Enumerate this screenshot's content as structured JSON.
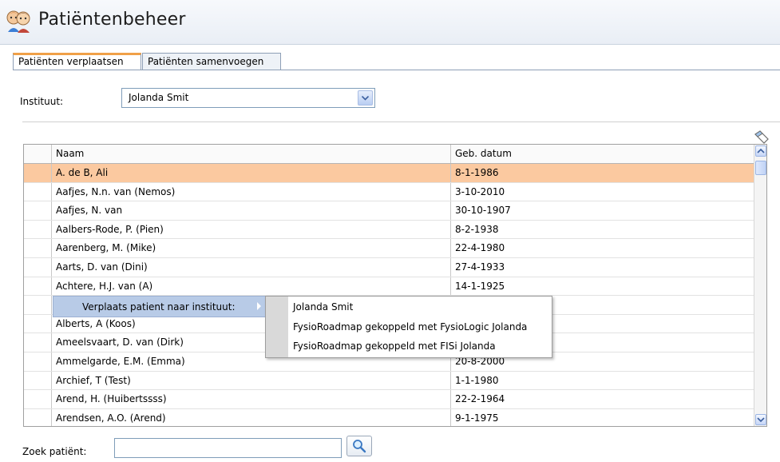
{
  "header": {
    "title": "Patiëntenbeheer"
  },
  "tabs": [
    {
      "label": "Patiënten verplaatsen",
      "active": true
    },
    {
      "label": "Patiënten samenvoegen",
      "active": false
    }
  ],
  "institute": {
    "label": "Instituut:",
    "value": "Jolanda Smit"
  },
  "table": {
    "columns": [
      "Naam",
      "Geb. datum"
    ],
    "rows": [
      {
        "name": "A. de B, Ali",
        "date": "8-1-1986",
        "selected": true
      },
      {
        "name": "Aafjes, N.n. van (Nemos)",
        "date": "3-10-2010"
      },
      {
        "name": "Aafjes, N. van",
        "date": "30-10-1907"
      },
      {
        "name": "Aalbers-Rode, P.  (Pien)",
        "date": "8-2-1938"
      },
      {
        "name": "Aarenberg, M.  (Mike)",
        "date": "22-4-1980"
      },
      {
        "name": "Aarts, D. van (Dini)",
        "date": "27-4-1933"
      },
      {
        "name": "Achtere, H.J. van (A)",
        "date": "14-1-1925"
      },
      {
        "name": "",
        "date": ""
      },
      {
        "name": "Alberts, A  (Koos)",
        "date": ""
      },
      {
        "name": "Ameelsvaart, D. van (Dirk)",
        "date": ""
      },
      {
        "name": "Ammelgarde, E.M.  (Emma)",
        "date": "20-8-2000"
      },
      {
        "name": "Archief, T  (Test)",
        "date": "1-1-1980"
      },
      {
        "name": "Arend, H.  (Huibertssss)",
        "date": "22-2-1964"
      },
      {
        "name": "Arendsen, A.O.  (Arend)",
        "date": "9-1-1975"
      }
    ]
  },
  "context_menu": {
    "item": "Verplaats patient naar instituut:",
    "submenu": [
      "Jolanda Smit",
      "FysioRoadmap gekoppeld met FysioLogic Jolanda",
      "FysioRoadmap gekoppeld met FISi Jolanda"
    ]
  },
  "search": {
    "label": "Zoek patiënt:",
    "value": ""
  },
  "colors": {
    "selected_row": "#fbc9a0",
    "context_highlight": "#b8cbe7",
    "tab_accent": "#f0a048"
  }
}
